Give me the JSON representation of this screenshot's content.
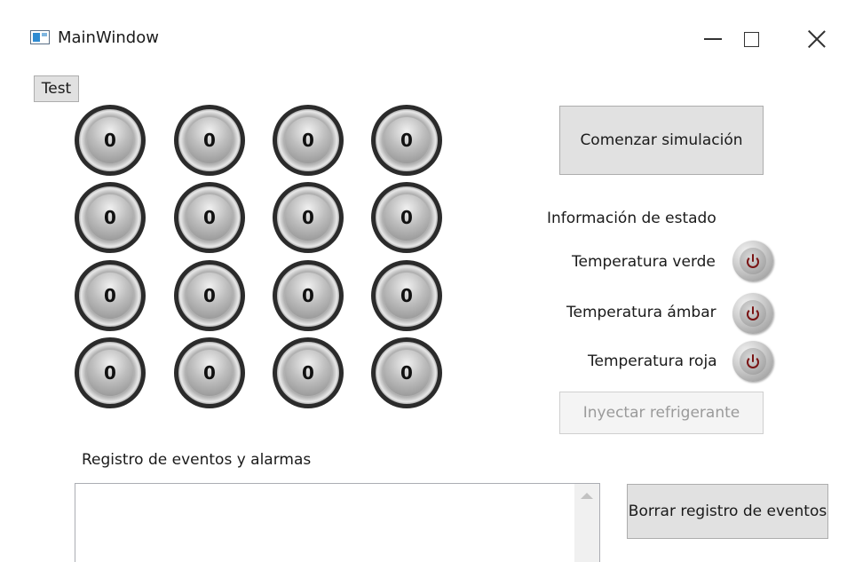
{
  "window": {
    "title": "MainWindow",
    "icon": "app-window-icon",
    "controls": [
      "minimize-icon",
      "maximize-icon",
      "close-icon"
    ]
  },
  "toolbar": {
    "test_label": "Test"
  },
  "gauges": {
    "icon": "gauge-dial-icon",
    "rows": [
      [
        "0",
        "0",
        "0",
        "0"
      ],
      [
        "0",
        "0",
        "0",
        "0"
      ],
      [
        "0",
        "0",
        "0",
        "0"
      ],
      [
        "0",
        "0",
        "0",
        "0"
      ]
    ]
  },
  "controls": {
    "start_label": "Comenzar simulación",
    "inject_label": "Inyectar refrigerante",
    "inject_enabled": false
  },
  "status": {
    "title": "Información de estado",
    "items": [
      {
        "label": "Temperatura verde",
        "icon": "power-icon",
        "indicator_color": "#7a1414"
      },
      {
        "label": "Temperatura ámbar",
        "icon": "power-icon",
        "indicator_color": "#7a1414"
      },
      {
        "label": "Temperatura roja",
        "icon": "power-icon",
        "indicator_color": "#7a1414"
      }
    ]
  },
  "log": {
    "title": "Registro de eventos y alarmas",
    "content": "",
    "clear_label": "Borrar registro de eventos"
  }
}
